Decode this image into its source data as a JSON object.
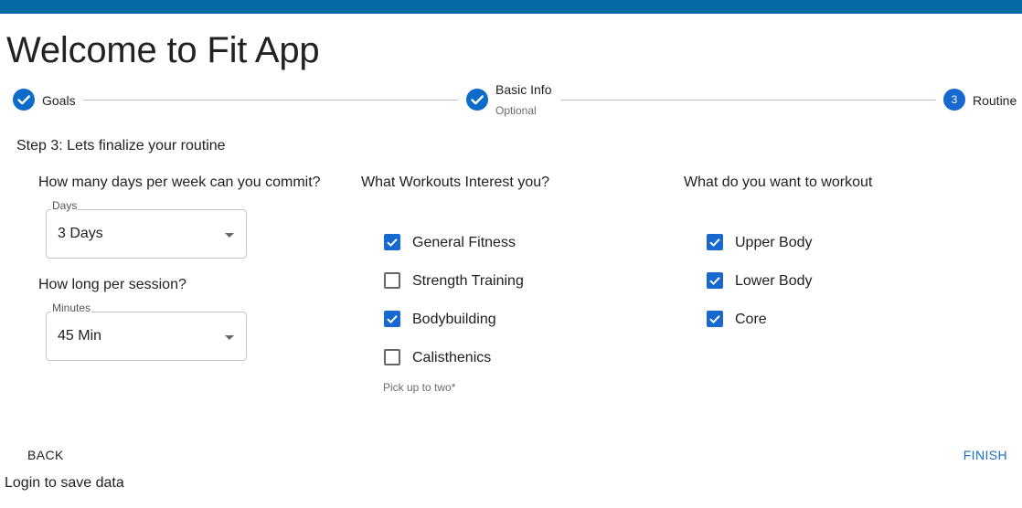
{
  "header": {
    "title": "Welcome to Fit App",
    "bar_color": "#046ba4"
  },
  "stepper": {
    "steps": [
      {
        "label": "Goals",
        "state": "completed",
        "icon": "check-icon"
      },
      {
        "label": "Basic Info",
        "optional_text": "Optional",
        "state": "completed",
        "icon": "check-icon"
      },
      {
        "label": "Routine",
        "number": "3",
        "state": "active"
      }
    ]
  },
  "step_heading": "Step 3: Lets finalize your routine",
  "schedule": {
    "days_question": "How many days per week can you commit?",
    "days_select": {
      "label": "Days",
      "value": "3 Days"
    },
    "session_question": "How long per session?",
    "minutes_select": {
      "label": "Minutes",
      "value": "45 Min"
    }
  },
  "workouts": {
    "question": "What Workouts Interest you?",
    "options": [
      {
        "label": "General Fitness",
        "checked": true
      },
      {
        "label": "Strength Training",
        "checked": false
      },
      {
        "label": "Bodybuilding",
        "checked": true
      },
      {
        "label": "Calisthenics",
        "checked": false
      }
    ],
    "helper": "Pick up to two*"
  },
  "body_areas": {
    "question": "What do you want to workout",
    "options": [
      {
        "label": "Upper Body",
        "checked": true
      },
      {
        "label": "Lower Body",
        "checked": true
      },
      {
        "label": "Core",
        "checked": true
      }
    ]
  },
  "actions": {
    "back_label": "BACK",
    "finish_label": "FINISH"
  },
  "footer": {
    "text": "Login to save data"
  },
  "colors": {
    "primary": "#1769cf",
    "bar": "#046ba4"
  }
}
